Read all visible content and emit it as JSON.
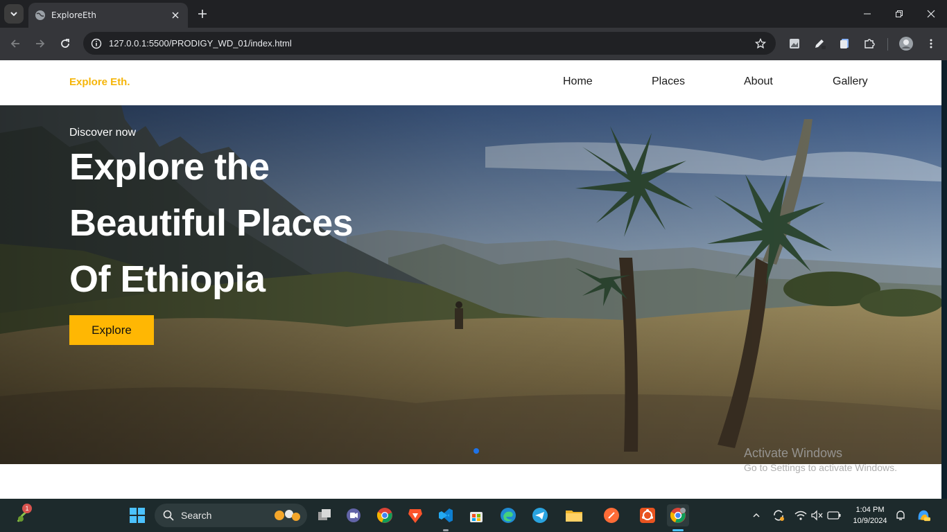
{
  "browser": {
    "tab_title": "ExploreEth",
    "url": "127.0.0.1:5500/PRODIGY_WD_01/index.html"
  },
  "site": {
    "brand": "Explore Eth.",
    "menu": [
      "Home",
      "Places",
      "About",
      "Gallery"
    ],
    "hero": {
      "kicker": "Discover now",
      "headline": [
        "Explore the",
        "Beautiful Places",
        "Of Ethiopia"
      ],
      "button": "Explore"
    }
  },
  "watermark": {
    "line1": "Activate Windows",
    "line2": "Go to Settings to activate Windows."
  },
  "taskbar": {
    "search_label": "Search",
    "notification_count": "1",
    "time": "1:04 PM",
    "date": "10/9/2024"
  },
  "colors": {
    "accent": "#ffb703",
    "brand": "#f5b50a",
    "browser_dark": "#202124",
    "toolbar": "#35363a",
    "taskbar": "#1d2a2c"
  }
}
